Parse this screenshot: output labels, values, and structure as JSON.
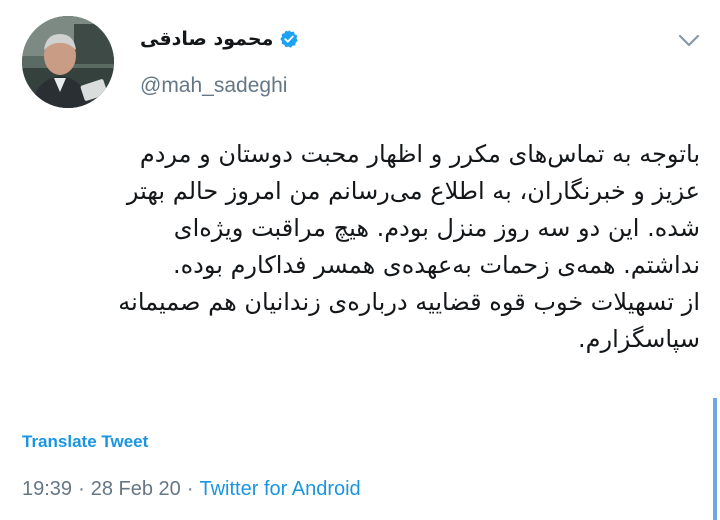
{
  "author": {
    "display_name": "محمود صادقی",
    "handle": "@mah_sadeghi",
    "verified": true,
    "avatar_icon": "profile-photo"
  },
  "tweet": {
    "lines": [
      "باتوجه به تماس‌های مکرر و اظهار محبت دوستان و مردم",
      "عزیز و خبرنگاران، به اطلاع می‌رسانم من امروز حالم بهتر",
      "شده. این دو سه روز منزل بودم. هیچ مراقبت ویژه‌ای",
      "نداشتم. همه‌ی زحمات به‌عهده‌ی همسر فداکارم بوده.",
      "از تسهیلات خوب قوه قضاییه درباره‌ی زندانیان هم صمیمانه",
      "سپاسگزارم."
    ],
    "translate_label": "Translate Tweet",
    "time": "19:39",
    "date": "28 Feb 20",
    "source": "Twitter for Android",
    "separator": "·"
  },
  "icons": {
    "menu": "chevron-down-icon",
    "verified": "verified-badge-icon"
  },
  "colors": {
    "link": "#1b95e0",
    "secondary_text": "#657786",
    "primary_text": "#14171a",
    "verified": "#1da1f2"
  }
}
